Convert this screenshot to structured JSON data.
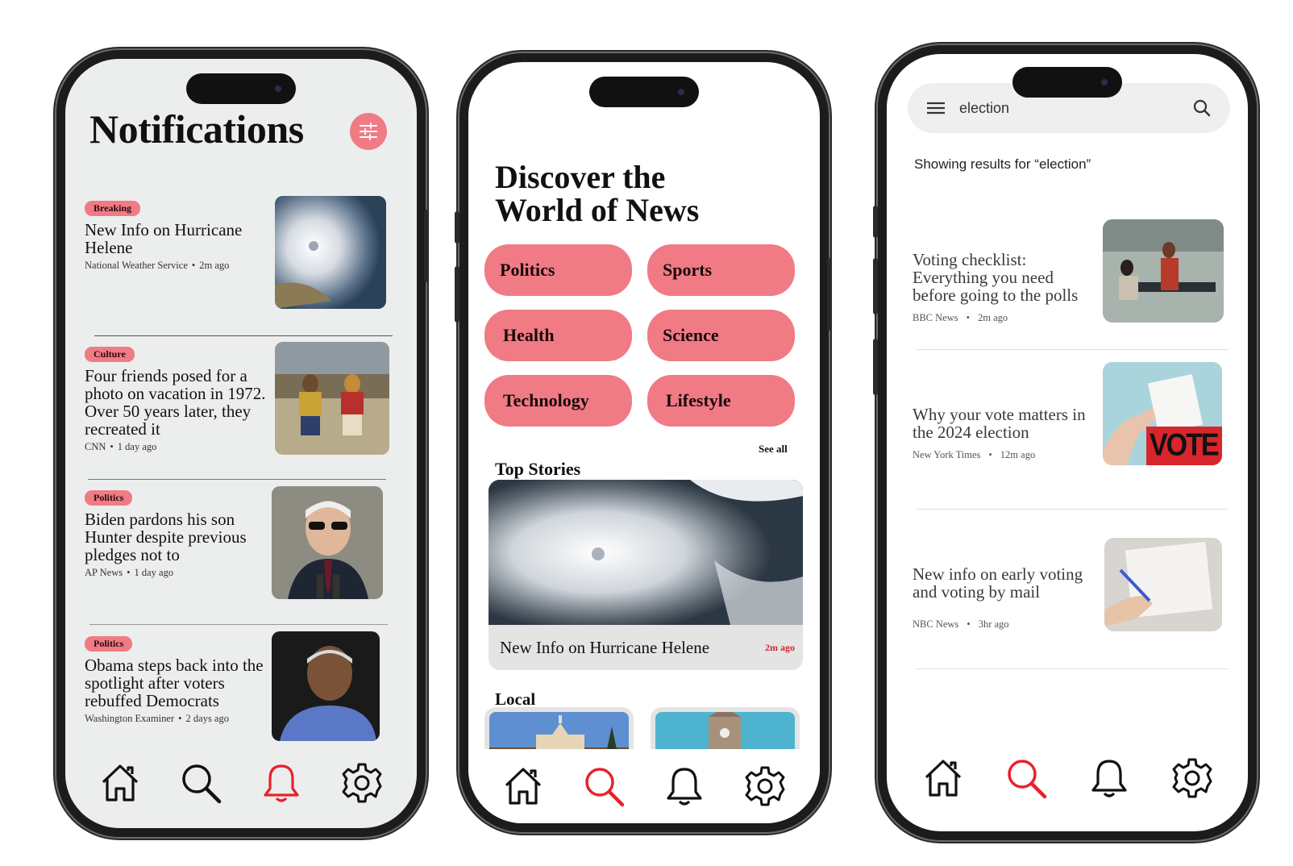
{
  "colors": {
    "accent": "#f07b85",
    "active_icon": "#e8212c",
    "tag_text": "#2a0c10"
  },
  "screen1": {
    "title": "Notifications",
    "filter_icon": "sliders-icon",
    "items": [
      {
        "tag": "Breaking",
        "headline": "New Info on Hurricane Helene",
        "source": "National Weather Service",
        "time": "2m ago"
      },
      {
        "tag": "Culture",
        "headline": "Four friends posed for a photo on vacation in 1972. Over 50 years later, they recreated it",
        "source": "CNN",
        "time": "1 day ago"
      },
      {
        "tag": "Politics",
        "headline": "Biden pardons his son Hunter despite previous pledges not to",
        "source": "AP News",
        "time": "1 day ago"
      },
      {
        "tag": "Politics",
        "headline": "Obama steps back into the spotlight after voters rebuffed Democrats",
        "source": "Washington Examiner",
        "time": "2 days ago"
      }
    ],
    "active_tab": "notifications"
  },
  "screen2": {
    "title_line1": "Discover the",
    "title_line2": "World of News",
    "categories": [
      "Politics",
      "Sports",
      "Health",
      "Science",
      "Technology",
      "Lifestyle"
    ],
    "see_all": "See all",
    "top_stories_label": "Top Stories",
    "top_story": {
      "headline": "New Info on Hurricane Helene",
      "time": "2m ago"
    },
    "local_label": "Local",
    "active_tab": "search"
  },
  "screen3": {
    "search_query": "election",
    "results_for": "Showing results for “election”",
    "results": [
      {
        "headline": "Voting checklist: Everything you need before going to the polls",
        "source": "BBC News",
        "time": "2m ago"
      },
      {
        "headline": "Why your vote matters in the 2024 election",
        "source": "New York Times",
        "time": "12m ago"
      },
      {
        "headline": "New info on early voting and voting by mail",
        "source": "NBC News",
        "time": "3hr ago"
      }
    ],
    "vote_sign": "VOTE",
    "active_tab": "search"
  },
  "tabs": [
    "home",
    "search",
    "notifications",
    "settings"
  ]
}
